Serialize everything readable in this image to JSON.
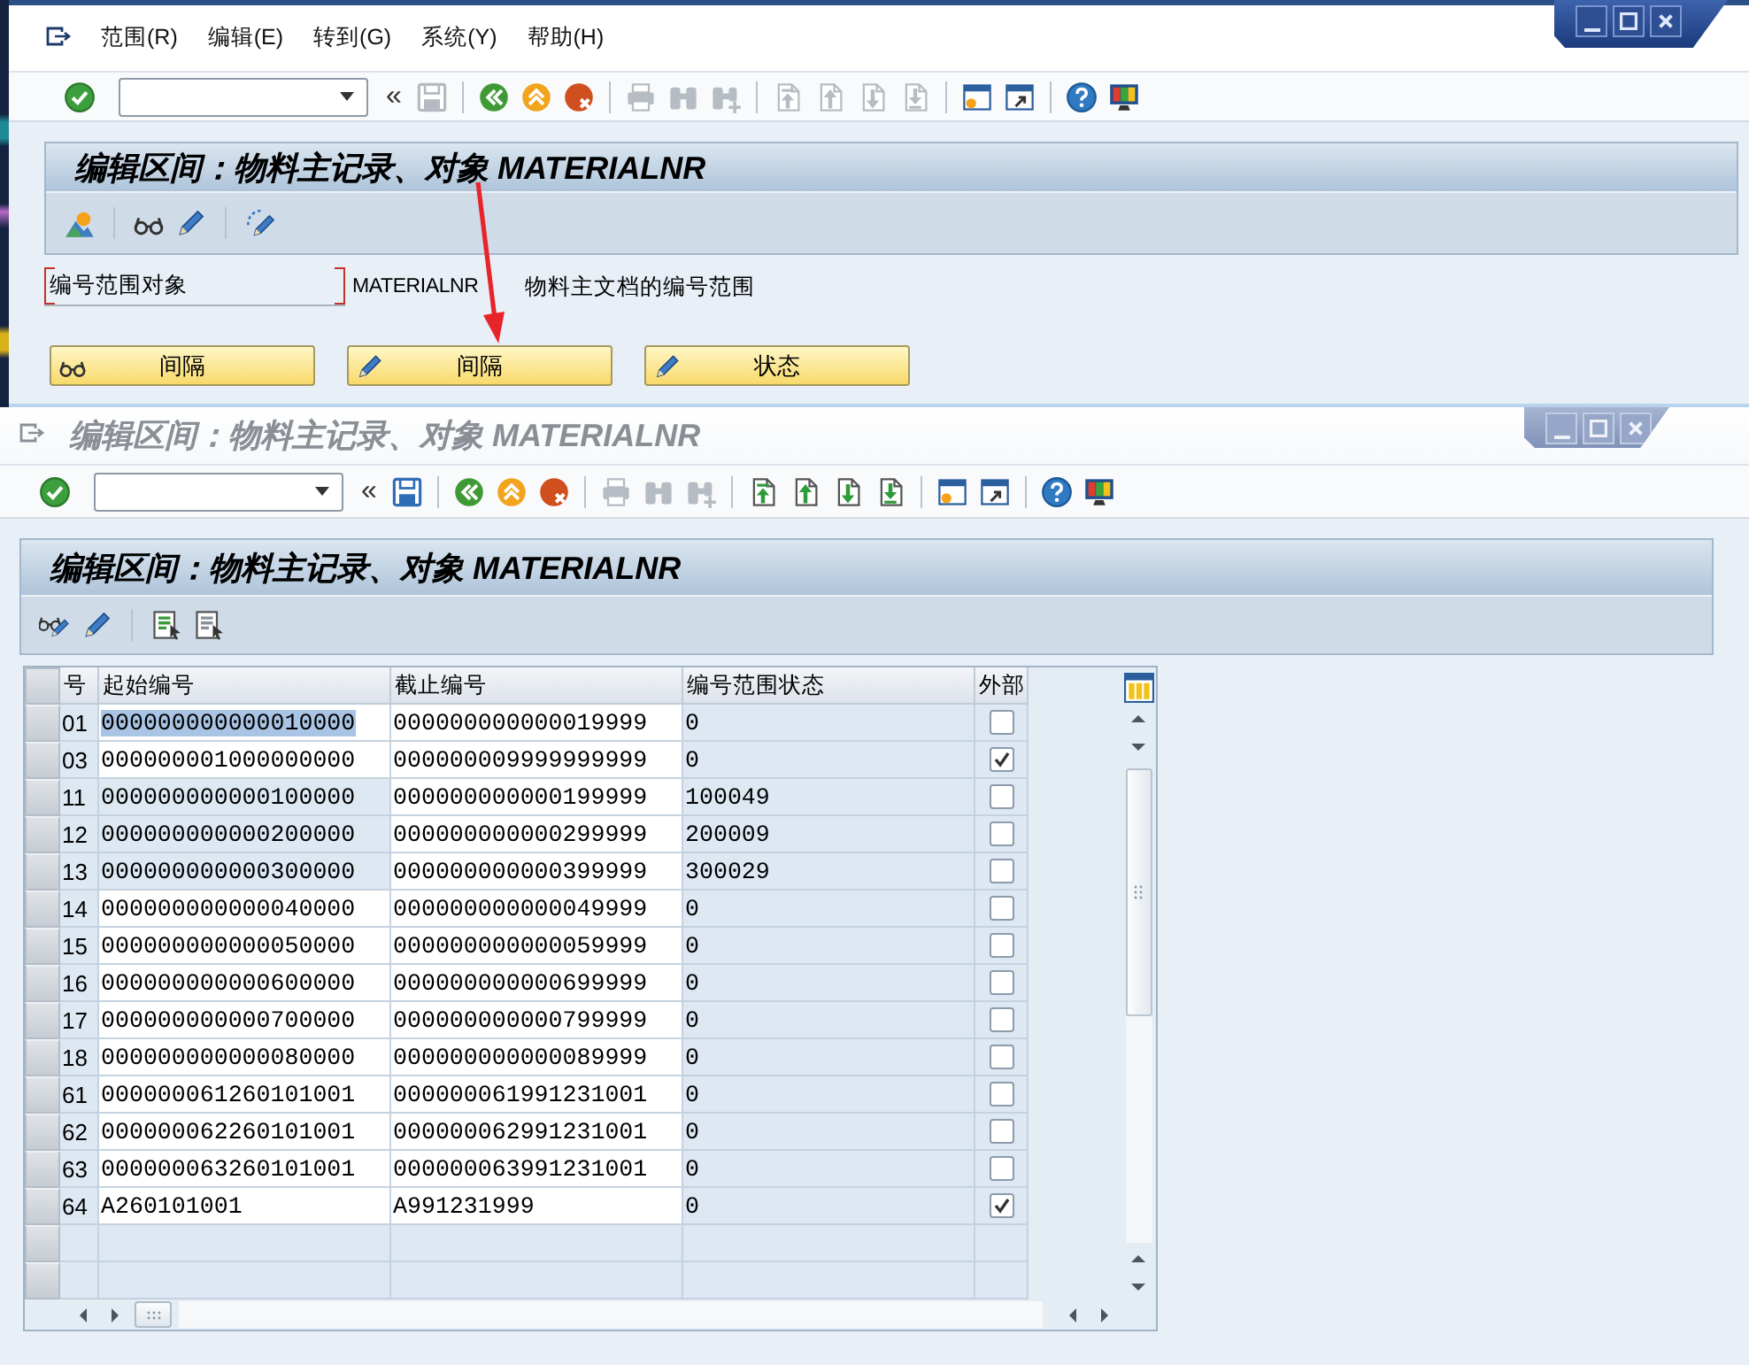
{
  "upper_window": {
    "active": true,
    "menu": [
      {
        "label": "范围(R)"
      },
      {
        "label": "编辑(E)"
      },
      {
        "label": "转到(G)"
      },
      {
        "label": "系统(Y)"
      },
      {
        "label": "帮助(H)"
      }
    ],
    "toolbar": {
      "enter_button": {
        "disabled": false
      },
      "collapse": "«",
      "groups": [
        [
          {
            "kind": "save",
            "disabled": true
          }
        ],
        [
          {
            "kind": "back",
            "disabled": false
          },
          {
            "kind": "exit",
            "disabled": false
          },
          {
            "kind": "cancel",
            "disabled": false
          }
        ],
        [
          {
            "kind": "print",
            "disabled": true
          },
          {
            "kind": "find",
            "disabled": true
          },
          {
            "kind": "find_next",
            "disabled": true
          }
        ],
        [
          {
            "kind": "first_page",
            "disabled": true
          },
          {
            "kind": "previous_page",
            "disabled": true
          },
          {
            "kind": "next_page",
            "disabled": true
          },
          {
            "kind": "last_page",
            "disabled": true
          }
        ],
        [
          {
            "kind": "new_session",
            "disabled": false
          },
          {
            "kind": "shortcut",
            "disabled": false
          }
        ],
        [
          {
            "kind": "help",
            "disabled": false
          },
          {
            "kind": "layout",
            "disabled": false
          }
        ]
      ]
    },
    "screen_title": "编辑区间：物料主记录、对象 MATERIALNR",
    "app_toolbar": [
      [
        {
          "kind": "overview"
        }
      ],
      [
        {
          "kind": "display"
        },
        {
          "kind": "change"
        }
      ],
      [
        {
          "kind": "change_documents"
        }
      ]
    ],
    "field": {
      "label": "编号范围对象",
      "focused": true,
      "value": "MATERIALNR",
      "description": "物料主文档的编号范围"
    },
    "buttons": [
      {
        "label": "间隔",
        "kind": "display"
      },
      {
        "label": "间隔",
        "kind": "change"
      },
      {
        "label": "状态",
        "kind": "change"
      }
    ]
  },
  "lower_window": {
    "active": false,
    "title": "编辑区间：物料主记录、对象 MATERIALNR",
    "toolbar": {
      "enter_button": {
        "disabled": false
      },
      "collapse": "«",
      "groups": [
        [
          {
            "kind": "save",
            "disabled": false
          }
        ],
        [
          {
            "kind": "back",
            "disabled": false
          },
          {
            "kind": "exit",
            "disabled": false
          },
          {
            "kind": "cancel",
            "disabled": false
          }
        ],
        [
          {
            "kind": "print",
            "disabled": true
          },
          {
            "kind": "find",
            "disabled": true
          },
          {
            "kind": "find_next",
            "disabled": true
          }
        ],
        [
          {
            "kind": "first_page",
            "disabled": false
          },
          {
            "kind": "previous_page",
            "disabled": false
          },
          {
            "kind": "next_page",
            "disabled": false
          },
          {
            "kind": "last_page",
            "disabled": false
          }
        ],
        [
          {
            "kind": "new_session",
            "disabled": false
          },
          {
            "kind": "shortcut",
            "disabled": false
          }
        ],
        [
          {
            "kind": "help",
            "disabled": false
          },
          {
            "kind": "layout",
            "disabled": false
          }
        ]
      ]
    },
    "screen_title": "编辑区间：物料主记录、对象 MATERIALNR",
    "app_toolbar": [
      [
        {
          "kind": "display_change"
        },
        {
          "kind": "change"
        }
      ],
      [
        {
          "kind": "select_all"
        },
        {
          "kind": "deselect_all"
        }
      ]
    ],
    "table": {
      "columns": [
        "号",
        "起始编号",
        "截止编号",
        "编号范围状态",
        "外部"
      ],
      "rows": [
        {
          "number": "01",
          "from": "000000000000010000",
          "to": "000000000000019999",
          "status": "0",
          "external": false,
          "from_locked": false,
          "from_text_selected": true
        },
        {
          "number": "03",
          "from": "000000001000000000",
          "to": "000000009999999999",
          "status": "0",
          "external": true,
          "from_locked": false,
          "from_text_selected": false
        },
        {
          "number": "11",
          "from": "000000000000100000",
          "to": "000000000000199999",
          "status": "100049",
          "external": false,
          "from_locked": true,
          "from_text_selected": false
        },
        {
          "number": "12",
          "from": "000000000000200000",
          "to": "000000000000299999",
          "status": "200009",
          "external": false,
          "from_locked": true,
          "from_text_selected": false
        },
        {
          "number": "13",
          "from": "000000000000300000",
          "to": "000000000000399999",
          "status": "300029",
          "external": false,
          "from_locked": true,
          "from_text_selected": false
        },
        {
          "number": "14",
          "from": "000000000000040000",
          "to": "000000000000049999",
          "status": "0",
          "external": false,
          "from_locked": false,
          "from_text_selected": false
        },
        {
          "number": "15",
          "from": "000000000000050000",
          "to": "000000000000059999",
          "status": "0",
          "external": false,
          "from_locked": false,
          "from_text_selected": false
        },
        {
          "number": "16",
          "from": "000000000000600000",
          "to": "000000000000699999",
          "status": "0",
          "external": false,
          "from_locked": false,
          "from_text_selected": false
        },
        {
          "number": "17",
          "from": "000000000000700000",
          "to": "000000000000799999",
          "status": "0",
          "external": false,
          "from_locked": false,
          "from_text_selected": false
        },
        {
          "number": "18",
          "from": "000000000000080000",
          "to": "000000000000089999",
          "status": "0",
          "external": false,
          "from_locked": false,
          "from_text_selected": false
        },
        {
          "number": "61",
          "from": "000000061260101001",
          "to": "000000061991231001",
          "status": "0",
          "external": false,
          "from_locked": false,
          "from_text_selected": false
        },
        {
          "number": "62",
          "from": "000000062260101001",
          "to": "000000062991231001",
          "status": "0",
          "external": false,
          "from_locked": false,
          "from_text_selected": false
        },
        {
          "number": "63",
          "from": "000000063260101001",
          "to": "000000063991231001",
          "status": "0",
          "external": false,
          "from_locked": false,
          "from_text_selected": false
        },
        {
          "number": "64",
          "from": "A260101001",
          "to": "A991231999",
          "status": "0",
          "external": true,
          "from_locked": false,
          "from_text_selected": false
        }
      ]
    }
  }
}
